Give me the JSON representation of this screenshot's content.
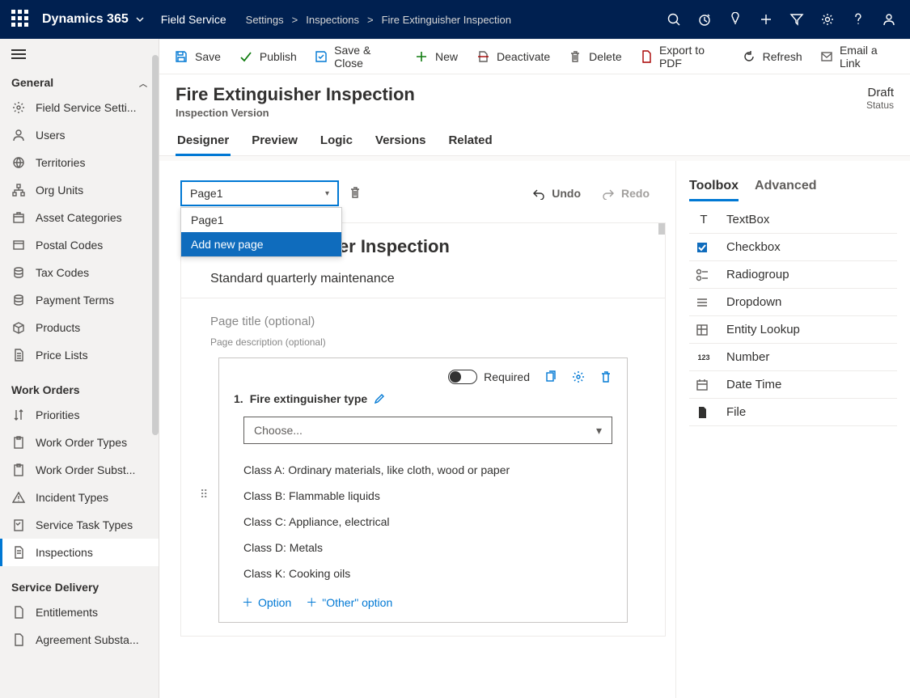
{
  "top": {
    "brand": "Dynamics 365",
    "module": "Field Service",
    "breadcrumb": [
      "Settings",
      "Inspections",
      "Fire Extinguisher Inspection"
    ]
  },
  "cmd": {
    "save": "Save",
    "publish": "Publish",
    "saveclose": "Save & Close",
    "new": "New",
    "deactivate": "Deactivate",
    "delete": "Delete",
    "exportpdf": "Export to PDF",
    "refresh": "Refresh",
    "emaillink": "Email a Link"
  },
  "head": {
    "title": "Fire Extinguisher Inspection",
    "subtitle": "Inspection Version",
    "status_value": "Draft",
    "status_label": "Status"
  },
  "tabs": [
    "Designer",
    "Preview",
    "Logic",
    "Versions",
    "Related"
  ],
  "sidebar": {
    "sections": [
      {
        "label": "General",
        "items": [
          {
            "label": "Field Service Setti..."
          },
          {
            "label": "Users"
          },
          {
            "label": "Territories"
          },
          {
            "label": "Org Units"
          },
          {
            "label": "Asset Categories"
          },
          {
            "label": "Postal Codes"
          },
          {
            "label": "Tax Codes"
          },
          {
            "label": "Payment Terms"
          },
          {
            "label": "Products"
          },
          {
            "label": "Price Lists"
          }
        ]
      },
      {
        "label": "Work Orders",
        "items": [
          {
            "label": "Priorities"
          },
          {
            "label": "Work Order Types"
          },
          {
            "label": "Work Order Subst..."
          },
          {
            "label": "Incident Types"
          },
          {
            "label": "Service Task Types"
          },
          {
            "label": "Inspections",
            "active": true
          }
        ]
      },
      {
        "label": "Service Delivery",
        "items": [
          {
            "label": "Entitlements"
          },
          {
            "label": "Agreement Substa..."
          }
        ]
      }
    ]
  },
  "design": {
    "page_selected": "Page1",
    "page_options": [
      "Page1",
      "Add new page"
    ],
    "undo": "Undo",
    "redo": "Redo",
    "card_title": "Fire Extinguisher Inspection",
    "card_desc": "Standard quarterly maintenance",
    "page_title_ph": "Page title (optional)",
    "page_desc_ph": "Page description (optional)",
    "q1": {
      "required_label": "Required",
      "number": "1.",
      "title": "Fire extinguisher type",
      "choose": "Choose...",
      "options": [
        "Class A: Ordinary materials, like cloth, wood or paper",
        "Class B: Flammable liquids",
        "Class C: Appliance, electrical",
        "Class D: Metals",
        "Class K: Cooking oils"
      ],
      "add_option": "Option",
      "add_other": "\"Other\" option"
    }
  },
  "right": {
    "tabs": [
      "Toolbox",
      "Advanced"
    ],
    "tools": [
      "TextBox",
      "Checkbox",
      "Radiogroup",
      "Dropdown",
      "Entity Lookup",
      "Number",
      "Date Time",
      "File"
    ]
  }
}
